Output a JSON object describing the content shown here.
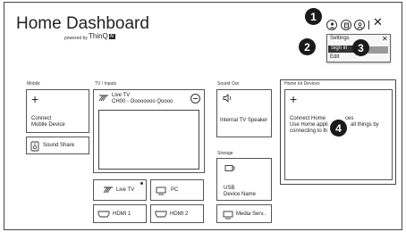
{
  "header": {
    "title": "Home Dashboard",
    "powered_by": "powered by",
    "brand": "ThinQ",
    "brand_badge": "AI"
  },
  "top_bar": {
    "close_glyph": "✕"
  },
  "callouts": [
    "1",
    "2",
    "3",
    "4"
  ],
  "account_menu": {
    "items": [
      "Settings",
      "Sign in",
      "Edit"
    ],
    "close_glyph": "✕"
  },
  "mobile": {
    "label": "Mobile",
    "connect_line1": "Connect",
    "connect_line2": "Mobile Device",
    "sound_share": "Sound Share"
  },
  "tv_inputs": {
    "label": "TV / Inputs",
    "live_tv_title": "Live TV",
    "live_tv_channel": "CH00 - Oooooooo Qoooo",
    "inputs": [
      "Live TV",
      "PC",
      "HDMI 1",
      "HDMI 2"
    ]
  },
  "sound_out": {
    "label": "Sound Out",
    "device": "Internal TV Speaker"
  },
  "storage": {
    "label": "Storage",
    "usb_line1": "USB",
    "usb_line2": "Device Name",
    "media_server": "Media Serv.."
  },
  "home_iot": {
    "label": "Home Iot Devices",
    "line1": "Connect Home",
    "line1_tail": "ces",
    "line2": "Use Home appli",
    "line2_tail": "all things by",
    "line3": "connecting to th"
  }
}
